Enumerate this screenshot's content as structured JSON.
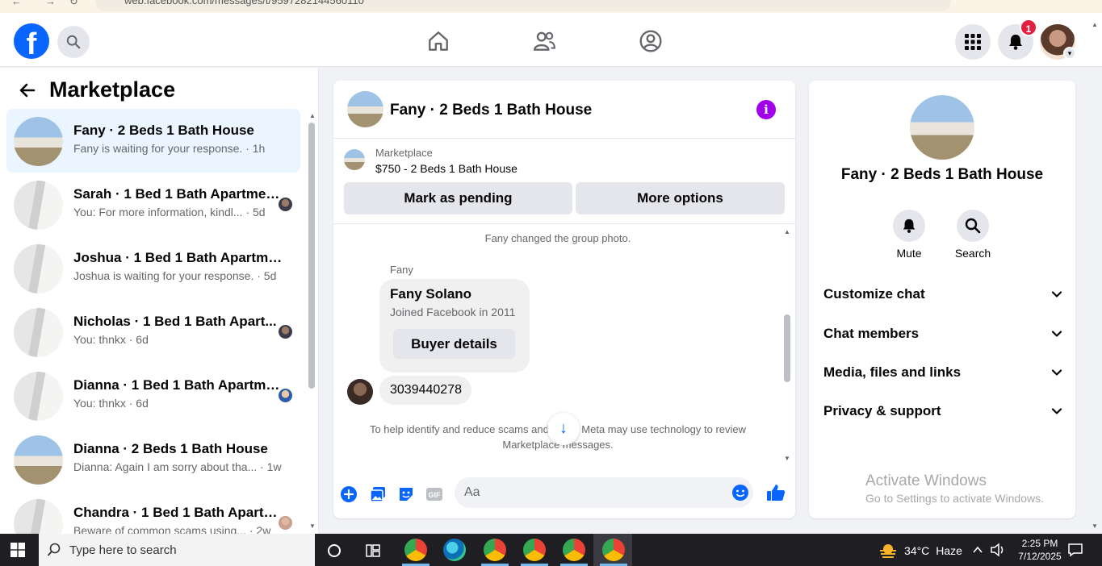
{
  "browser": {
    "url": "web.facebook.com/messages/t/9597282144560110"
  },
  "topbar": {
    "logo": "f",
    "notif_count": "1",
    "icons": [
      "search-icon",
      "home-icon",
      "friends-icon",
      "profile-icon",
      "apps-grid-icon",
      "bell-icon",
      "avatar"
    ]
  },
  "sidebar": {
    "title": "Marketplace",
    "conversations": [
      {
        "title": "Fany · 2 Beds 1 Bath House",
        "sub": "Fany is waiting for your response. · 1h",
        "active": true
      },
      {
        "title": "Sarah · 1 Bed 1 Bath Apartmen...",
        "sub": "You: For more information, kindl... · 5d"
      },
      {
        "title": "Joshua · 1 Bed 1 Bath Apartment...",
        "sub": "Joshua is waiting for your response. · 5d"
      },
      {
        "title": "Nicholas · 1 Bed 1 Bath Apart...",
        "sub": "You: thnkx · 6d"
      },
      {
        "title": "Dianna · 1 Bed 1 Bath Apartme...",
        "sub": "You: thnkx · 6d"
      },
      {
        "title": "Dianna · 2 Beds 1 Bath House",
        "sub": "Dianna: Again I am sorry about tha... · 1w"
      },
      {
        "title": "Chandra · 1 Bed 1 Bath Apartm...",
        "sub": "Beware of common scams using... · 2w"
      }
    ]
  },
  "chat": {
    "title": "Fany · 2 Beds 1 Bath House",
    "listing_label": "Marketplace",
    "listing_price": "$750 - 2 Beds 1 Bath House",
    "mark_pending": "Mark as pending",
    "more_options": "More options",
    "system_msg": "Fany changed the group photo.",
    "sender": "Fany",
    "card_name": "Fany Solano",
    "card_joined": "Joined Facebook in 2011",
    "buyer_details": "Buyer details",
    "phone": "3039440278",
    "notice": "To help identify and reduce scams and fraud, Meta may use technology to review Marketplace messages.",
    "composer_placeholder": "Aa"
  },
  "rpanel": {
    "title": "Fany · 2 Beds 1 Bath House",
    "mute": "Mute",
    "search": "Search",
    "rows": [
      "Customize chat",
      "Chat members",
      "Media, files and links",
      "Privacy & support"
    ]
  },
  "watermark": {
    "line1": "Activate Windows",
    "line2": "Go to Settings to activate Windows."
  },
  "taskbar": {
    "search_placeholder": "Type here to search",
    "temp": "34°C",
    "weather": "Haze",
    "time": "2:25 PM",
    "date": "7/12/2025"
  },
  "colors": {
    "brand": "#0866ff",
    "info": "#a100e8",
    "active_row": "#ebf5ff"
  }
}
